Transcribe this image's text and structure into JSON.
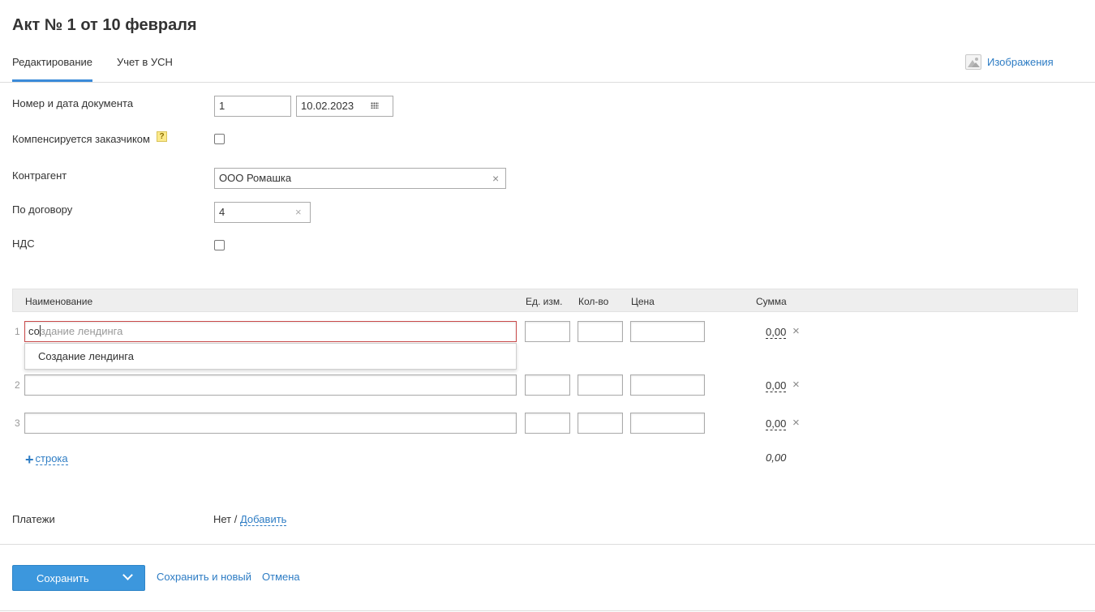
{
  "page": {
    "title": "Акт № 1 от 10 февраля"
  },
  "tabs": [
    {
      "label": "Редактирование",
      "active": true
    },
    {
      "label": "Учет в УСН",
      "active": false
    }
  ],
  "images_link": {
    "label": "Изображения",
    "icon": "image-icon"
  },
  "form": {
    "doc_number_label": "Номер и дата документа",
    "doc_number_value": "1",
    "doc_date_value": "10.02.2023",
    "compensated_label": "Компенсируется заказчиком",
    "compensated_checked": false,
    "help_symbol": "?",
    "counterparty_label": "Контрагент",
    "counterparty_value": "ООО Ромашка",
    "contract_label": "По договору",
    "contract_value": "4",
    "vat_label": "НДС",
    "vat_checked": false,
    "clear_symbol": "×"
  },
  "table": {
    "headers": {
      "name": "Наименование",
      "unit": "Ед. изм.",
      "qty": "Кол-во",
      "price": "Цена",
      "sum": "Сумма"
    },
    "rows": [
      {
        "num": "1",
        "name": "со",
        "unit": "",
        "qty": "",
        "price": "",
        "sum": "0,00"
      },
      {
        "num": "2",
        "name": "",
        "unit": "",
        "qty": "",
        "price": "",
        "sum": "0,00"
      },
      {
        "num": "3",
        "name": "",
        "unit": "",
        "qty": "",
        "price": "",
        "sum": "0,00"
      }
    ],
    "autocomplete": {
      "typed": "со",
      "ghost_completion": "здание лендинга",
      "suggestion": "Создание лендинга"
    },
    "delete_symbol": "×",
    "add_row_label": "строка",
    "add_row_symbol": "+",
    "total": "0,00"
  },
  "payments": {
    "label": "Платежи",
    "none_text": "Нет / ",
    "add_label": "Добавить"
  },
  "actions": {
    "save": "Сохранить",
    "save_and_new": "Сохранить и новый",
    "cancel": "Отмена"
  },
  "colors": {
    "accent": "#3c97dd",
    "link": "#2d7cc4",
    "active_border": "#c94a4a"
  }
}
